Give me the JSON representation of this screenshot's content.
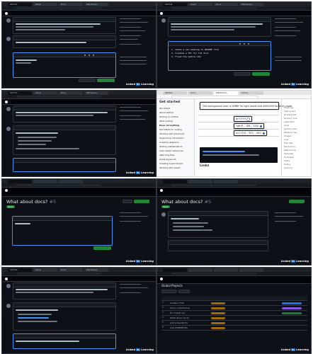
{
  "brand": {
    "label": "Linked",
    "badge": "in",
    "suffix": "Learning"
  },
  "panels": {
    "p1": {
      "tabs": [
        "GitHub",
        "Issue",
        "Docs",
        "Markdown"
      ]
    },
    "p2": {
      "tabs": [
        "GitHub",
        "Issue",
        "Docs",
        "Markdown"
      ],
      "code_lines": [
        "1. Added a new heading to README file",
        "2. Created a TOC for the docs",
        "3. Fixed the mobile CSS"
      ]
    },
    "p3": {
      "tabs": [
        "GitHub",
        "Issue",
        "Docs",
        "Markdown"
      ]
    },
    "p4": {
      "tabs": [
        "GitHub",
        "Docs",
        "Markdown",
        "Colors"
      ],
      "sidebar_title": "Get started",
      "nav": [
        "Quickstart",
        "About GitHub",
        "Writing on GitHub",
        "Start writing",
        "Basic formatting",
        "Quickstart for writing",
        "Working with advanced",
        "Organizing information",
        "Creating diagrams",
        "Writing mathematical",
        "Auto-linked references",
        "Attaching files",
        "Using keywords",
        "Creating a permanent",
        "Working with saved"
      ],
      "callout": "The background color is #ffffff for light mode and #000000 for dark mode.",
      "pills": [
        {
          "text": "#ffffff",
          "color": "#ffffff"
        },
        {
          "text": "rgb(9, 105, 218)",
          "color": "#0969da"
        },
        {
          "text": "hsl(212, 92%, 45%)",
          "color": "#0969da"
        }
      ],
      "links_heading": "Links",
      "on_page": [
        "Headings",
        "Styling text",
        "Quoting text",
        "Quoting code",
        "Supported",
        "Links",
        "Section links",
        "Relative links",
        "Images",
        "Lists",
        "Task lists",
        "Mentioning",
        "Referencing",
        "Uploaded",
        "Footnotes",
        "Alerts",
        "Hiding",
        "Ignoring"
      ]
    },
    "p5": {
      "title": "What about docs?",
      "number": "#5",
      "status": "Open"
    },
    "p6": {
      "title": "What about docs?",
      "number": "#5",
      "status": "Open"
    },
    "p7": {
      "tabs": [
        "GitHub",
        "Issue",
        "Docs",
        "Markdown"
      ]
    },
    "p8": {
      "title": "Global Projects",
      "rows": [
        {
          "num": "1",
          "name": "Create a TOC"
        },
        {
          "num": "2",
          "name": "Add a contributing"
        },
        {
          "num": "3",
          "name": "Fix mobile css"
        },
        {
          "num": "4",
          "name": "What about docs?"
        },
        {
          "num": "5",
          "name": "Add screenshots"
        },
        {
          "num": "6",
          "name": "Add LICENSE file"
        }
      ]
    }
  },
  "colors": {
    "dark_bg": "#0d1117",
    "green": "#238636",
    "blue": "#4493f8",
    "linkedin": "#0a66c2"
  }
}
